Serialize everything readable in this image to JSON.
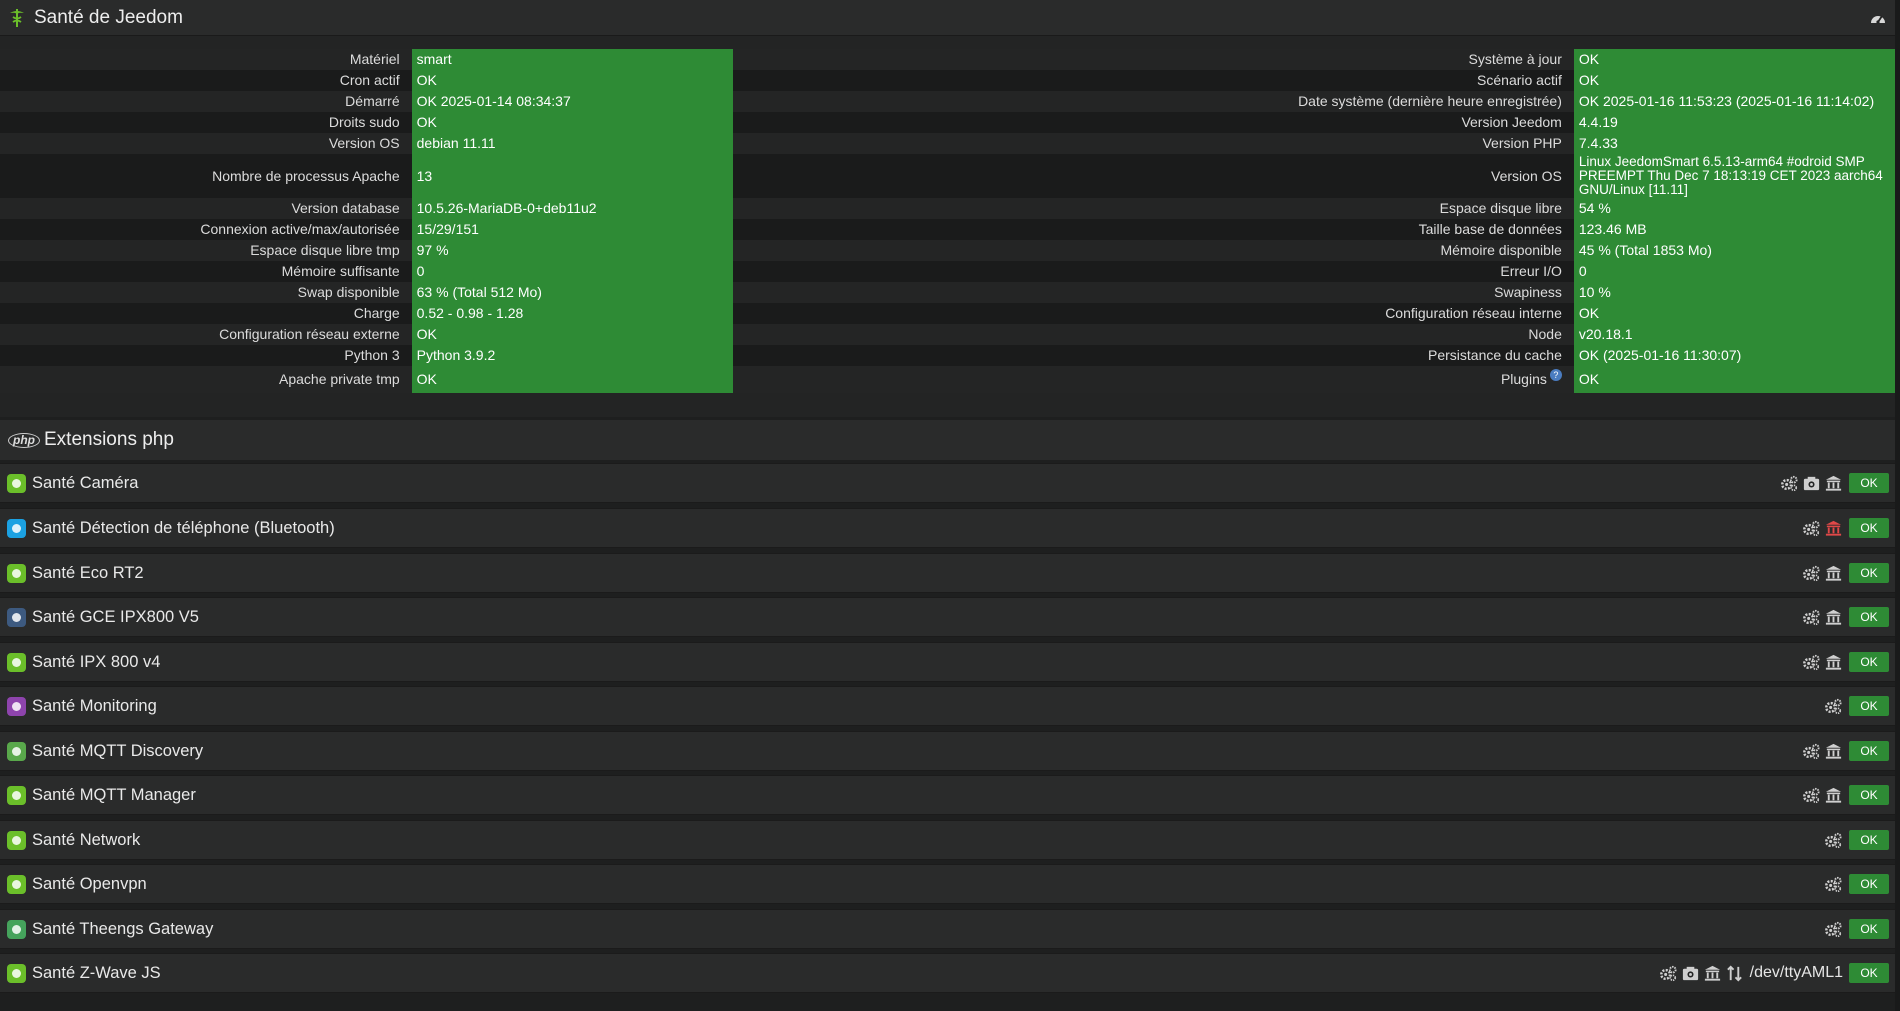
{
  "health": {
    "title": "Santé de Jeedom",
    "rows": [
      {
        "l_label": "Matériel",
        "l_value": "smart",
        "r_label": "Système à jour",
        "r_value": "OK"
      },
      {
        "l_label": "Cron actif",
        "l_value": "OK",
        "r_label": "Scénario actif",
        "r_value": "OK"
      },
      {
        "l_label": "Démarré",
        "l_value": "OK 2025-01-14 08:34:37",
        "r_label": "Date système (dernière heure enregistrée)",
        "r_value": "OK 2025-01-16 11:53:23 (2025-01-16 11:14:02)"
      },
      {
        "l_label": "Droits sudo",
        "l_value": "OK",
        "r_label": "Version Jeedom",
        "r_value": "4.4.19"
      },
      {
        "l_label": "Version OS",
        "l_value": "debian 11.11",
        "r_label": "Version PHP",
        "r_value": "7.4.33"
      },
      {
        "l_label": "Nombre de processus Apache",
        "l_value": "13",
        "r_label": "Version OS",
        "r_value": "Linux JeedomSmart 6.5.13-arm64 #odroid SMP PREEMPT Thu Dec 7 18:13:19 CET 2023 aarch64 GNU/Linux [11.11]"
      },
      {
        "l_label": "Version database",
        "l_value": "10.5.26-MariaDB-0+deb11u2",
        "r_label": "Espace disque libre",
        "r_value": "54 %"
      },
      {
        "l_label": "Connexion active/max/autorisée",
        "l_value": "15/29/151",
        "r_label": "Taille base de données",
        "r_value": "123.46 MB"
      },
      {
        "l_label": "Espace disque libre tmp",
        "l_value": "97 %",
        "r_label": "Mémoire disponible",
        "r_value": "45 % (Total 1853 Mo)"
      },
      {
        "l_label": "Mémoire suffisante",
        "l_value": "0",
        "r_label": "Erreur I/O",
        "r_value": "0"
      },
      {
        "l_label": "Swap disponible",
        "l_value": "63 % (Total 512 Mo)",
        "r_label": "Swapiness",
        "r_value": "10 %"
      },
      {
        "l_label": "Charge",
        "l_value": "0.52 - 0.98 - 1.28",
        "r_label": "Configuration réseau interne",
        "r_value": "OK"
      },
      {
        "l_label": "Configuration réseau externe",
        "l_value": "OK",
        "r_label": "Node",
        "r_value": "v20.18.1"
      },
      {
        "l_label": "Python 3",
        "l_value": "Python 3.9.2",
        "r_label": "Persistance du cache",
        "r_value": "OK (2025-01-16 11:30:07)"
      },
      {
        "l_label": "Apache private tmp",
        "l_value": "OK",
        "r_label": "Plugins",
        "r_value": "OK"
      }
    ],
    "plugins_help": "?"
  },
  "php": {
    "badge": "php",
    "title": "Extensions php"
  },
  "extensions": [
    {
      "title": "Santé Caméra",
      "status": "OK",
      "icon_color": "#6bbf2a"
    },
    {
      "title": "Santé Détection de téléphone (Bluetooth)",
      "status": "OK",
      "icon_color": "#1ba1e2"
    },
    {
      "title": "Santé Eco RT2",
      "status": "OK",
      "icon_color": "#6bbf2a"
    },
    {
      "title": "Santé GCE IPX800 V5",
      "status": "OK",
      "icon_color": "#3d5a80"
    },
    {
      "title": "Santé IPX 800 v4",
      "status": "OK",
      "icon_color": "#6bbf2a"
    },
    {
      "title": "Santé Monitoring",
      "status": "OK",
      "icon_color": "#8e44ad"
    },
    {
      "title": "Santé MQTT Discovery",
      "status": "OK",
      "icon_color": "#59a84b"
    },
    {
      "title": "Santé MQTT Manager",
      "status": "OK",
      "icon_color": "#6bbf2a"
    },
    {
      "title": "Santé Network",
      "status": "OK",
      "icon_color": "#6bbf2a"
    },
    {
      "title": "Santé Openvpn",
      "status": "OK",
      "icon_color": "#6bbf2a"
    },
    {
      "title": "Santé Theengs Gateway",
      "status": "OK",
      "icon_color": "#45a35c"
    },
    {
      "title": "Santé Z-Wave JS",
      "status": "OK",
      "icon_color": "#6bbf2a",
      "port": "/dev/ttyAML1"
    }
  ],
  "colors": {
    "ok_green": "#2e8b35",
    "danger_red": "#e04848",
    "icon_grey": "#cfcfcf"
  }
}
